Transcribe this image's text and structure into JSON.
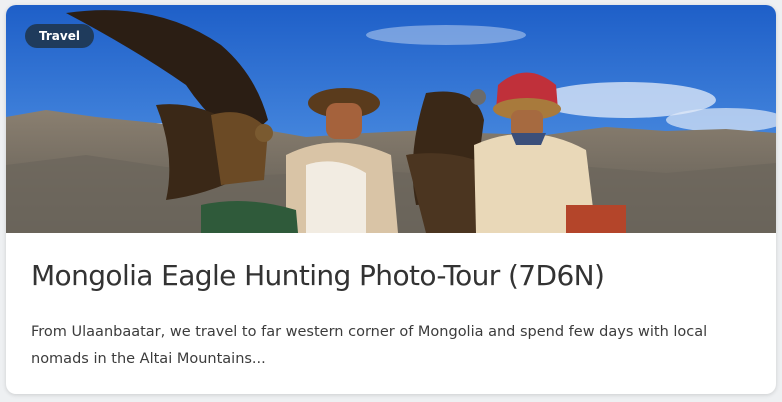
{
  "card": {
    "category_badge": "Travel",
    "title": "Mongolia Eagle Hunting Photo-Tour (7D6N)",
    "description": "From Ulaanbaatar, we travel to far western corner of Mongolia and spend few days with local nomads in the Altai Mountains..."
  },
  "hero_image": {
    "content": "Two Kazakh eagle hunters in fur hats holding golden eagles on rocky mountain slopes under a blue sky"
  },
  "colors": {
    "badge_bg": "#1f3b5c",
    "title_text": "#333333",
    "body_text": "#3c3c3c",
    "sky": "#2f6fd0"
  }
}
